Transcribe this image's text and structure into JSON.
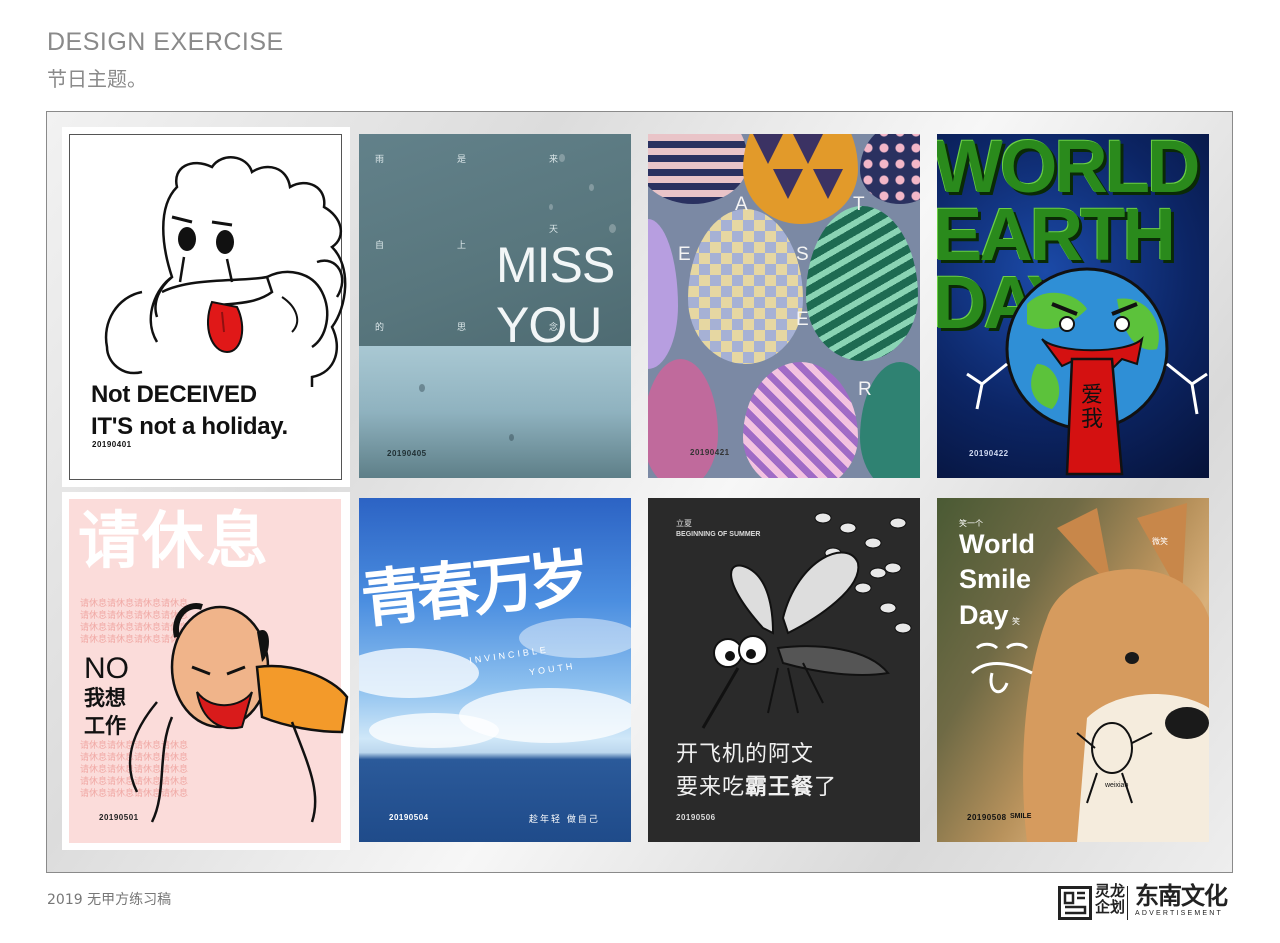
{
  "header": {
    "title_en": "DESIGN EXERCISE",
    "title_cn": "节日主题。"
  },
  "posters": [
    {
      "line1": "Not DECEIVED",
      "line2": "IT'S not a holiday.",
      "date": "20190401"
    },
    {
      "cn_col1": "雨",
      "cn_col2": "是",
      "cn_col3": "来",
      "cn_col4": "自",
      "cn_col5": "上",
      "cn_col6": "天",
      "cn_col7": "的",
      "cn_col8": "思",
      "cn_col9": "念",
      "title1": "MISS",
      "title2": "YOU",
      "date": "20190405"
    },
    {
      "letters": [
        "E",
        "A",
        "S",
        "T",
        "E",
        "R"
      ],
      "date": "20190421"
    },
    {
      "title_lines": [
        "WORLD",
        "EARTH",
        "DAY"
      ],
      "love_text": "爱我",
      "date": "20190422"
    },
    {
      "big_title": "请休息",
      "repeat_text": "请休息请休息请休息请休息",
      "no": "NO",
      "want1": "我想",
      "want2": "工作",
      "date": "20190501"
    },
    {
      "title": "青春万岁",
      "sub1": "INVINCIBLE",
      "sub2": "YOUTH",
      "slogan": "趁年轻 做自己",
      "date": "20190504"
    },
    {
      "small_cn": "立夏",
      "small_en": "BEGINNING OF SUMMER",
      "line1": "开飞机的阿文",
      "line2a": "要来吃",
      "line2b": "霸王餐",
      "line2c": "了",
      "date": "20190506"
    },
    {
      "small_top": "笑一个",
      "t1": "World",
      "t2": "Smile",
      "t3": "Day",
      "small_cn1": "微笑",
      "small_cn2": "笑",
      "weixiao": "weixiao",
      "date": "20190508",
      "smile": "SMILE"
    }
  ],
  "footer": {
    "text": "2019 无甲方练习稿"
  },
  "logo": {
    "cn1": "灵龙企划",
    "cn2": "东南文化",
    "en": "ADVERTISEMENT"
  }
}
